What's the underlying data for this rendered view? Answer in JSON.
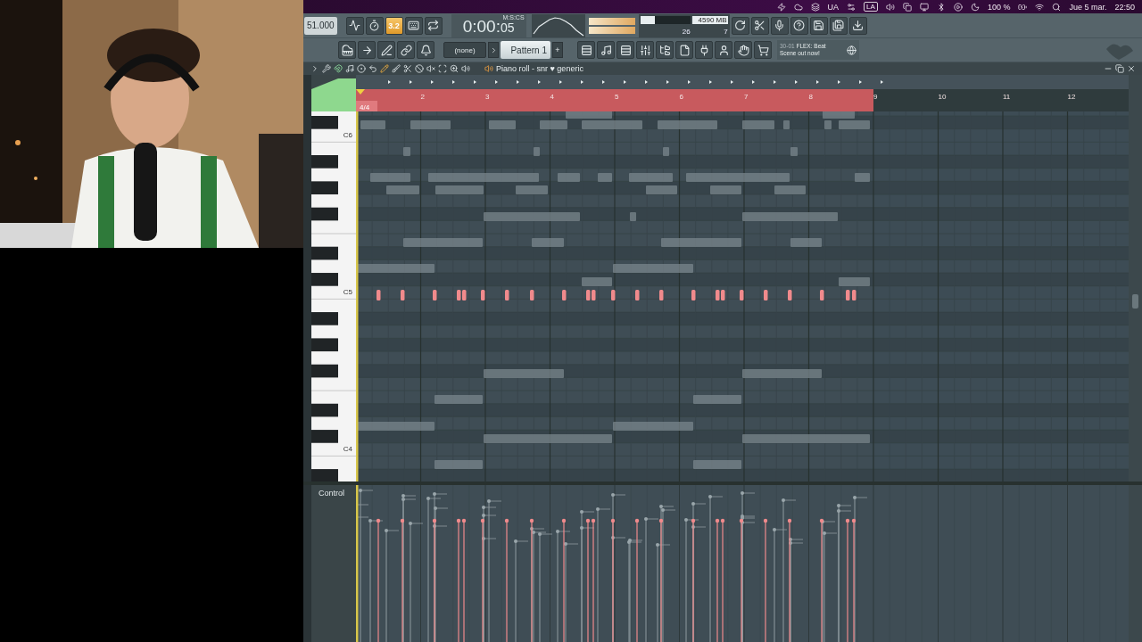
{
  "menu_bar": {
    "ua": "UA",
    "la": "LA",
    "battery": "100 %",
    "date": "Jue 5 mar.",
    "time": "22:50"
  },
  "toolbar": {
    "tempo": "51.000",
    "typing_keyboard": {
      "label": "3.2",
      "on": true
    },
    "clock_main": "0:00:",
    "clock_centis": "05",
    "clock_unit": "M:S:CS",
    "cpu": "26",
    "memory": "4590 MB",
    "polyphony": "7",
    "channel_dropdown": "(none)",
    "pattern": "Pattern 1",
    "pattern_add": "+",
    "hint_code": "30-01",
    "hint_lines": [
      "FLEX: Beat",
      "Scene out now!"
    ]
  },
  "piano_roll": {
    "title": "Piano roll - snr ♥ generic",
    "time_signature": "4/4",
    "bars": [
      "2",
      "3",
      "4",
      "5",
      "6",
      "7",
      "8",
      "9",
      "10",
      "11",
      "12"
    ],
    "key_labels": [
      "C6",
      "C5",
      "C4"
    ],
    "control_label": "Control"
  }
}
